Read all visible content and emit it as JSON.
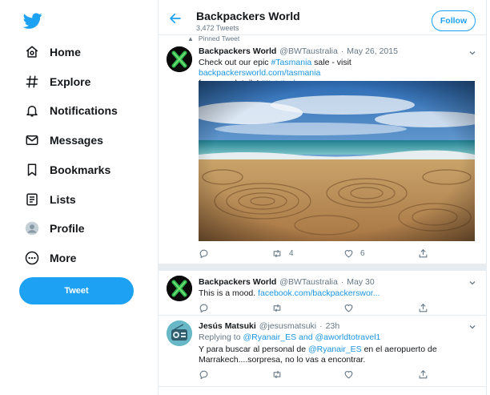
{
  "nav": {
    "items": [
      {
        "label": "Home",
        "icon": "home-icon"
      },
      {
        "label": "Explore",
        "icon": "hashtag-icon"
      },
      {
        "label": "Notifications",
        "icon": "bell-icon"
      },
      {
        "label": "Messages",
        "icon": "envelope-icon"
      },
      {
        "label": "Bookmarks",
        "icon": "bookmark-icon"
      },
      {
        "label": "Lists",
        "icon": "list-icon"
      },
      {
        "label": "Profile",
        "icon": "profile-avatar-icon"
      },
      {
        "label": "More",
        "icon": "more-circle-icon"
      }
    ],
    "tweet_button": "Tweet"
  },
  "header": {
    "title": "Backpackers World",
    "tweet_count": "3,472 Tweets",
    "follow_label": "Follow"
  },
  "pinned_label": "Pinned Tweet",
  "tweets": [
    {
      "name": "Backpackers World",
      "handle": "@BWTaustralia",
      "sep": "·",
      "date": "May 26, 2015",
      "text_1": "Check out our epic ",
      "tag_1": "#Tasmania",
      "text_2": " sale - visit ",
      "link_1": "backpackersworld.com/tasmania",
      "text_3": "for more details! ",
      "tag_2": "#ttot",
      "text_4": " ",
      "tag_3": "#sale",
      "retweets": "4",
      "likes": "6"
    },
    {
      "name": "Backpackers World",
      "handle": "@BWTaustralia",
      "sep": "·",
      "date": "May 30",
      "text_1": "This is a mood. ",
      "link_1": "facebook.com/backpackerswor..."
    },
    {
      "name": "Jesús Matsuki",
      "handle": "@jesusmatsuki",
      "sep": "·",
      "date": "23h",
      "reply_prefix": "Replying to ",
      "reply_1": "@Ryanair_ES",
      "reply_and": " and ",
      "reply_2": "@aworldtotravel1",
      "text_1": "Y para buscar al personal de ",
      "mention": "@Ryanair_ES",
      "text_2": " en el aeropuerto de Marrakech....sorpresa, no lo vas a encontrar."
    }
  ],
  "colors": {
    "accent": "#1da1f2",
    "link": "#1b95e0",
    "muted": "#657786",
    "divider": "#e6ecf0"
  }
}
